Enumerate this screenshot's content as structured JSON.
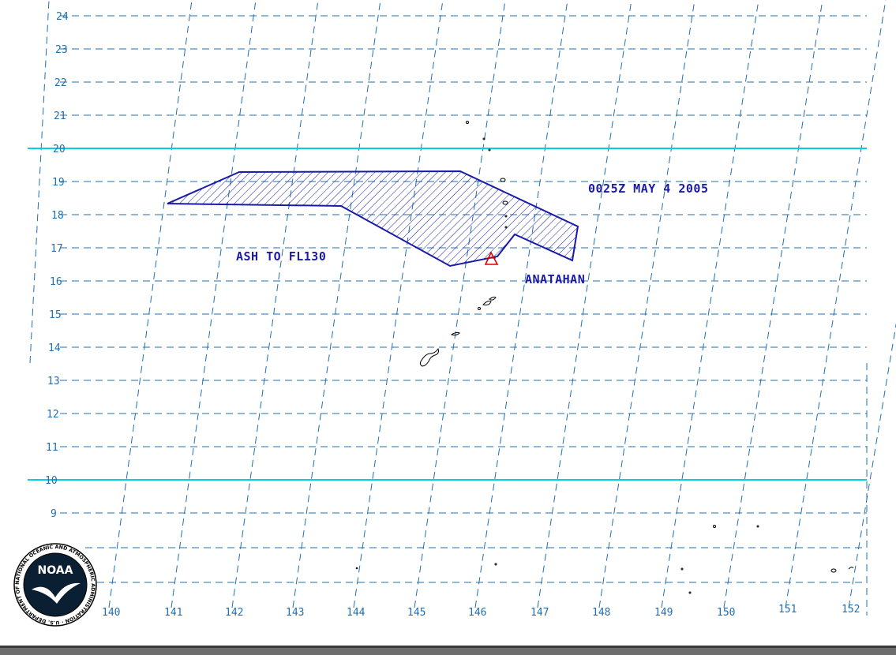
{
  "map": {
    "lat_labels": [
      "24",
      "23",
      "22",
      "21",
      "20",
      "19",
      "18",
      "17",
      "16",
      "15",
      "14",
      "13",
      "12",
      "11",
      "10",
      "9"
    ],
    "lon_labels": [
      "140",
      "141",
      "142",
      "143",
      "144",
      "145",
      "146",
      "147",
      "148",
      "149",
      "150",
      "151",
      "152"
    ],
    "highlight_lats": [
      "20",
      "10"
    ],
    "annotations": {
      "time": "0025Z MAY 4 2005",
      "ash": "ASH TO FL130",
      "volcano": "ANATAHAN"
    },
    "logo": {
      "text": "NOAA",
      "ring_text": "NATIONAL OCEANIC AND ATMOSPHERIC ADMINISTRATION · U.S. DEPARTMENT OF COMMERCE"
    },
    "colors": {
      "grid": "#1f6fb2",
      "highlight": "#00d0e0",
      "ash": "#1a1aa6",
      "volcano": "#e00000",
      "coast": "#000000"
    }
  }
}
